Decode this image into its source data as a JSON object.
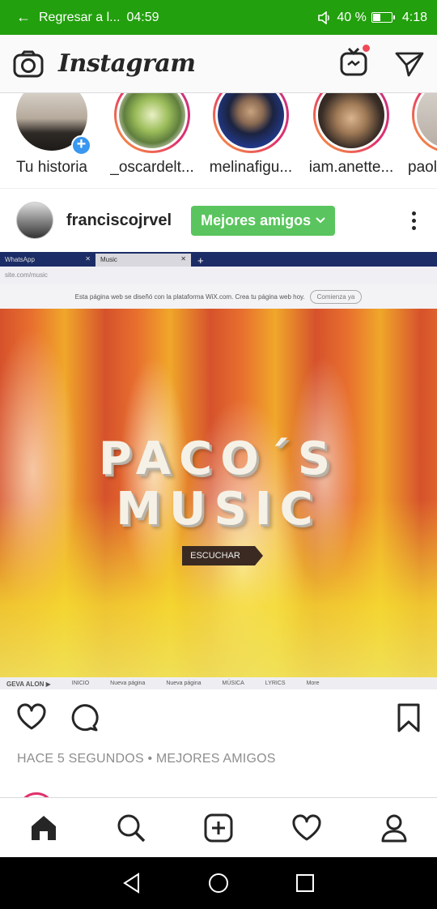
{
  "status_bar": {
    "return_label": "Regresar a l...",
    "call_time": "04:59",
    "battery_percent": "40 %",
    "battery_level": 0.4,
    "clock": "4:18",
    "bg_color": "#22a00d"
  },
  "header": {
    "app_name": "Instagram",
    "icons": [
      "camera-icon",
      "igtv-icon",
      "direct-message-icon"
    ]
  },
  "stories": [
    {
      "label": "Tu historia",
      "own": true
    },
    {
      "label": "_oscardelt..."
    },
    {
      "label": "melinafigu..."
    },
    {
      "label": "iam.anette..."
    },
    {
      "label": "paol"
    }
  ],
  "post": {
    "username": "franciscojrvel",
    "badge": "Mejores amigos",
    "browser": {
      "tab1": "WhatsApp",
      "tab2": "Music",
      "address": "site.com/music",
      "wix_notice": "Esta página web se diseñó con la plataforma WiX.com. Crea tu página web hoy.",
      "wix_button": "Comienza ya"
    },
    "hero_line1": "PACO´S",
    "hero_line2": "MUSIC",
    "listen_button": "ESCUCHAR",
    "site_nav": [
      "GEVA ALON ▶",
      "INICIO",
      "Nueva página",
      "Nueva página",
      "MÚSICA",
      "LYRICS",
      "More"
    ],
    "meta": "HACE 5 SEGUNDOS • MEJORES AMIGOS"
  },
  "bottom_nav": [
    "home-icon",
    "search-icon",
    "add-post-icon",
    "activity-heart-icon",
    "profile-icon"
  ],
  "accent_colors": {
    "best_friends": "#5ac55e",
    "add_story": "#3897f0",
    "notification": "#ed4956"
  }
}
